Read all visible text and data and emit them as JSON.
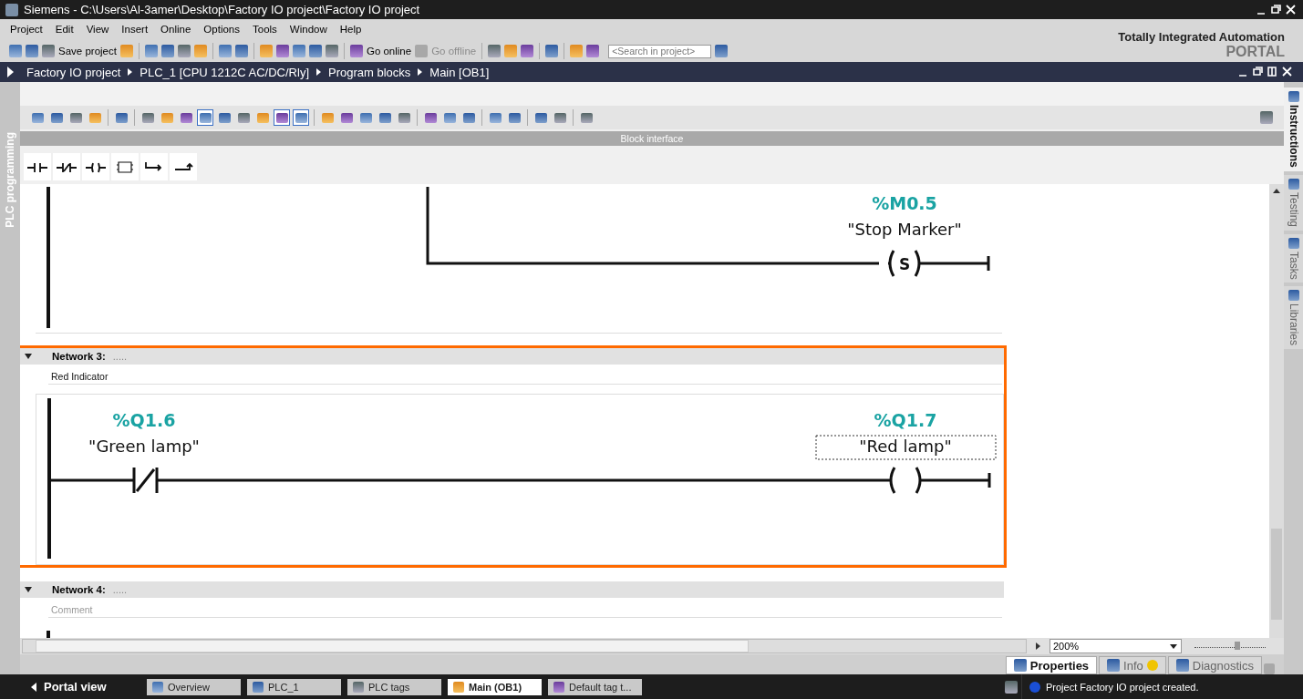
{
  "window": {
    "title": "Siemens  -  C:\\Users\\Al-3amer\\Desktop\\Factory IO project\\Factory IO project"
  },
  "menu": [
    "Project",
    "Edit",
    "View",
    "Insert",
    "Online",
    "Options",
    "Tools",
    "Window",
    "Help"
  ],
  "toolbar": [
    {
      "kind": "icon"
    },
    {
      "kind": "icon"
    },
    {
      "kind": "labeled",
      "label": "Save project",
      "disabled": false
    },
    {
      "kind": "icon"
    },
    {
      "kind": "sep"
    },
    {
      "kind": "icon"
    },
    {
      "kind": "icon"
    },
    {
      "kind": "icon"
    },
    {
      "kind": "icon"
    },
    {
      "kind": "sep"
    },
    {
      "kind": "icon"
    },
    {
      "kind": "icon"
    },
    {
      "kind": "sep"
    },
    {
      "kind": "icon"
    },
    {
      "kind": "icon"
    },
    {
      "kind": "icon"
    },
    {
      "kind": "icon"
    },
    {
      "kind": "icon"
    },
    {
      "kind": "sep"
    },
    {
      "kind": "labeled",
      "label": "Go online",
      "disabled": false
    },
    {
      "kind": "labeled",
      "label": "Go offline",
      "disabled": true
    },
    {
      "kind": "sep"
    },
    {
      "kind": "icon"
    },
    {
      "kind": "icon"
    },
    {
      "kind": "icon"
    },
    {
      "kind": "sep"
    },
    {
      "kind": "icon"
    },
    {
      "kind": "sep"
    },
    {
      "kind": "icon"
    },
    {
      "kind": "icon"
    }
  ],
  "search": {
    "placeholder": "<Search in project>"
  },
  "branding": {
    "line1": "Totally Integrated Automation",
    "line2": "PORTAL"
  },
  "breadcrumb": [
    "Factory IO project",
    "PLC_1 [CPU 1212C AC/DC/Rly]",
    "Program blocks",
    "Main [OB1]"
  ],
  "left_tab": "PLC programming",
  "right_tabs": [
    {
      "label": "Instructions",
      "selected": true
    },
    {
      "label": "Testing",
      "selected": false
    },
    {
      "label": "Tasks",
      "selected": false
    },
    {
      "label": "Libraries",
      "selected": false
    }
  ],
  "editor_tool_groups": [
    [
      {
        "pressed": false
      },
      {
        "pressed": false
      },
      {
        "pressed": false
      },
      {
        "pressed": false
      }
    ],
    [
      {
        "pressed": false
      }
    ],
    [
      {
        "pressed": false
      },
      {
        "pressed": false
      },
      {
        "pressed": false
      },
      {
        "pressed": true
      },
      {
        "pressed": false
      },
      {
        "pressed": false
      },
      {
        "pressed": false
      },
      {
        "pressed": true
      },
      {
        "pressed": true
      }
    ],
    [
      {
        "pressed": false
      },
      {
        "pressed": false
      },
      {
        "pressed": false
      },
      {
        "pressed": false
      },
      {
        "pressed": false
      }
    ],
    [
      {
        "pressed": false
      },
      {
        "pressed": false
      },
      {
        "pressed": false
      }
    ],
    [
      {
        "pressed": false
      },
      {
        "pressed": false
      }
    ],
    [
      {
        "pressed": false
      },
      {
        "pressed": false
      }
    ],
    [
      {
        "pressed": false
      }
    ]
  ],
  "block_interface": "Block interface",
  "ladder_tools": [
    {
      "kind": "no"
    },
    {
      "kind": "nc"
    },
    {
      "kind": "coil"
    },
    {
      "kind": "box"
    },
    {
      "kind": "branch_open"
    },
    {
      "kind": "branch_close"
    }
  ],
  "networks": [
    {
      "kind": "partial",
      "highlighted": false,
      "coil": {
        "address": "%M0.5",
        "tag": "\"Stop Marker\"",
        "kind": "set",
        "letter": "S",
        "selected": false
      }
    },
    {
      "kind": "full",
      "title": "Network 3:",
      "dots": ".....",
      "comment": "Red Indicator",
      "highlighted": true,
      "contact": {
        "address": "%Q1.6",
        "tag": "\"Green lamp\"",
        "kind": "nc"
      },
      "coil": {
        "address": "%Q1.7",
        "tag": "\"Red lamp\"",
        "kind": "plain",
        "selected": true
      }
    },
    {
      "kind": "empty",
      "title": "Network 4:",
      "dots": ".....",
      "comment_placeholder": "Comment",
      "highlighted": false
    }
  ],
  "zoom": "200%",
  "zoom_slider": {
    "level": 0.6
  },
  "inspector_tabs": [
    {
      "label": "Properties",
      "selected": true
    },
    {
      "label": "Info",
      "selected": false
    },
    {
      "label": "Diagnostics",
      "selected": false
    }
  ],
  "portal_view": "Portal view",
  "editors": [
    {
      "label": "Overview",
      "selected": false
    },
    {
      "label": "PLC_1",
      "selected": false
    },
    {
      "label": "PLC tags",
      "selected": false
    },
    {
      "label": "Main (OB1)",
      "selected": true
    },
    {
      "label": "Default tag t...",
      "selected": false
    }
  ],
  "status": "Project Factory IO project created."
}
